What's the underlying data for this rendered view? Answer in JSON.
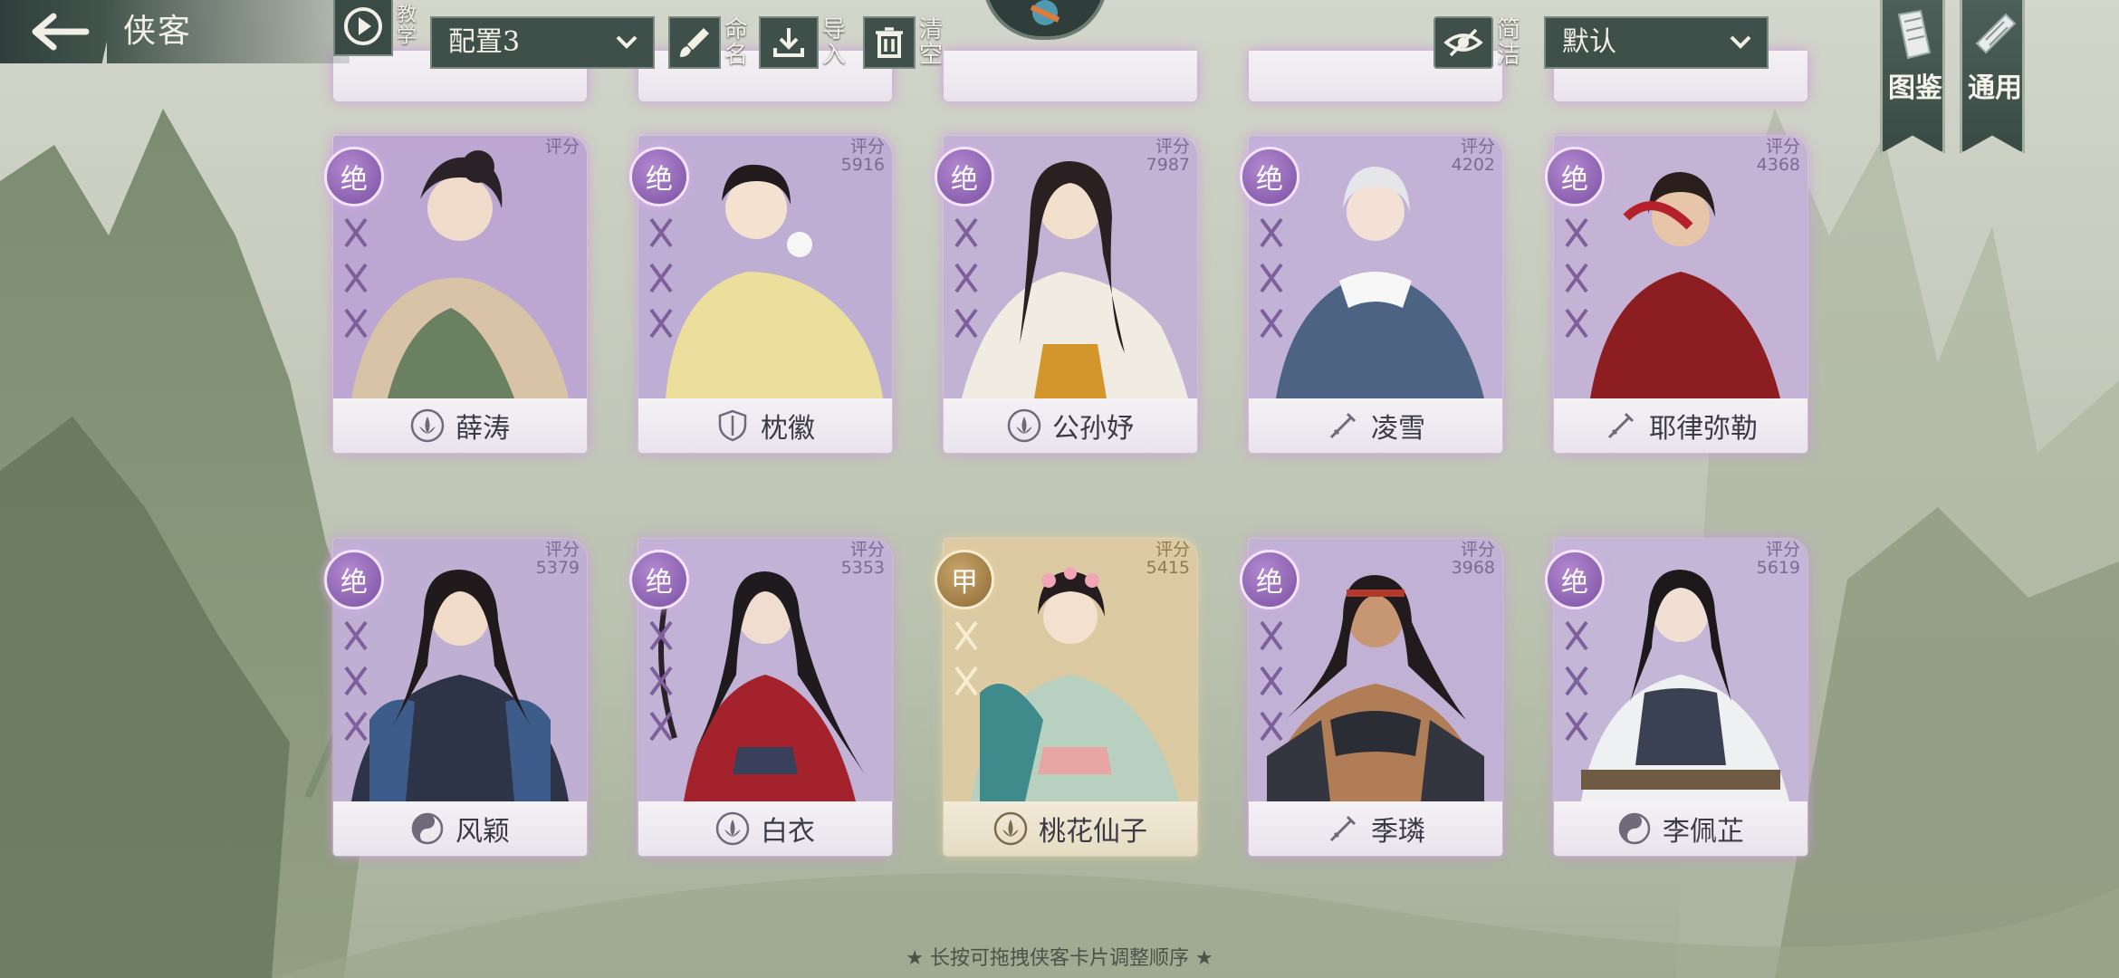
{
  "header": {
    "title": "侠客",
    "tutorial_label": "教学",
    "config_select": "配置3",
    "rename_label": "命名",
    "import_label": "导入",
    "clear_label": "清空",
    "simple_label": "简洁",
    "sort_select": "默认",
    "codex_label": "图鉴",
    "general_label": "通用"
  },
  "cards_row1": [
    {
      "rank": "绝",
      "score_label": "评分",
      "score": "",
      "name": "薛涛",
      "school": "lotus"
    },
    {
      "rank": "绝",
      "score_label": "评分",
      "score": "5916",
      "name": "枕徽",
      "school": "shield"
    },
    {
      "rank": "绝",
      "score_label": "评分",
      "score": "7987",
      "name": "公孙妤",
      "school": "lotus"
    },
    {
      "rank": "绝",
      "score_label": "评分",
      "score": "4202",
      "name": "凌雪",
      "school": "sword"
    },
    {
      "rank": "绝",
      "score_label": "评分",
      "score": "4368",
      "name": "耶律弥勒",
      "school": "sword"
    }
  ],
  "cards_row2": [
    {
      "rank": "绝",
      "score_label": "评分",
      "score": "5379",
      "name": "风颖",
      "school": "taiji"
    },
    {
      "rank": "绝",
      "score_label": "评分",
      "score": "5353",
      "name": "白衣",
      "school": "lotus"
    },
    {
      "rank": "甲",
      "score_label": "评分",
      "score": "5415",
      "name": "桃花仙子",
      "school": "lotus"
    },
    {
      "rank": "绝",
      "score_label": "评分",
      "score": "3968",
      "name": "季璘",
      "school": "sword"
    },
    {
      "rank": "绝",
      "score_label": "评分",
      "score": "5619",
      "name": "李佩芷",
      "school": "taiji"
    }
  ],
  "hint": "★ 长按可拖拽侠客卡片调整顺序 ★",
  "colors": {
    "card_purple": "#a28bbd",
    "card_gold": "#cdb68a",
    "topbar_dark": "#3f504a",
    "rank_purple": "#7b4fa3",
    "rank_gold": "#8c6a34"
  }
}
